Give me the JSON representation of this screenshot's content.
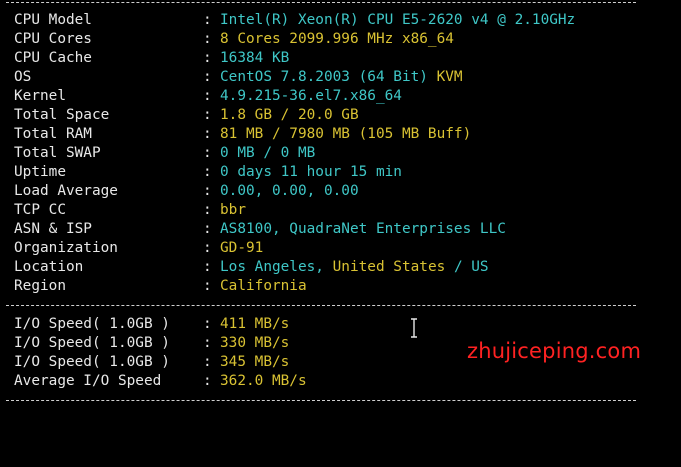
{
  "colors": {
    "background": "#000000",
    "label": "#e8e8e8",
    "separator": "#cfcfcf",
    "cyan": "#3fc7c7",
    "yellow": "#d9c233",
    "watermark": "#ff2222"
  },
  "system_info": [
    {
      "label": "CPU Model",
      "parts": [
        {
          "text": "Intel(R) Xeon(R) CPU E5-2620 v4 @ 2.10GHz",
          "color": "cyan"
        }
      ]
    },
    {
      "label": "CPU Cores",
      "parts": [
        {
          "text": "8 Cores 2099.996 MHz x86_64",
          "color": "yellow"
        }
      ]
    },
    {
      "label": "CPU Cache",
      "parts": [
        {
          "text": "16384 KB",
          "color": "cyan"
        }
      ]
    },
    {
      "label": "OS",
      "parts": [
        {
          "text": "CentOS 7.8.2003 (64 Bit) ",
          "color": "cyan"
        },
        {
          "text": "KVM",
          "color": "yellow"
        }
      ]
    },
    {
      "label": "Kernel",
      "parts": [
        {
          "text": "4.9.215-36.el7.x86_64",
          "color": "cyan"
        }
      ]
    },
    {
      "label": "Total Space",
      "parts": [
        {
          "text": "1.8 GB / 20.0 GB",
          "color": "yellow"
        }
      ]
    },
    {
      "label": "Total RAM",
      "parts": [
        {
          "text": "81 MB / 7980 MB (105 MB Buff)",
          "color": "yellow"
        }
      ]
    },
    {
      "label": "Total SWAP",
      "parts": [
        {
          "text": "0 MB / 0 MB",
          "color": "cyan"
        }
      ]
    },
    {
      "label": "Uptime",
      "parts": [
        {
          "text": "0 days 11 hour 15 min",
          "color": "cyan"
        }
      ]
    },
    {
      "label": "Load Average",
      "parts": [
        {
          "text": "0.00, 0.00, 0.00",
          "color": "cyan"
        }
      ]
    },
    {
      "label": "TCP CC",
      "parts": [
        {
          "text": "bbr",
          "color": "yellow"
        }
      ]
    },
    {
      "label": "ASN & ISP",
      "parts": [
        {
          "text": "AS8100, QuadraNet Enterprises LLC",
          "color": "cyan"
        }
      ]
    },
    {
      "label": "Organization",
      "parts": [
        {
          "text": "GD-91",
          "color": "yellow"
        }
      ]
    },
    {
      "label": "Location",
      "parts": [
        {
          "text": "Los Angeles, ",
          "color": "cyan"
        },
        {
          "text": "United States",
          "color": "yellow"
        },
        {
          "text": " / US",
          "color": "cyan"
        }
      ]
    },
    {
      "label": "Region",
      "parts": [
        {
          "text": "California",
          "color": "yellow"
        }
      ]
    }
  ],
  "io_speed": [
    {
      "label": "I/O Speed( 1.0GB )",
      "parts": [
        {
          "text": "411 MB/s",
          "color": "yellow"
        }
      ]
    },
    {
      "label": "I/O Speed( 1.0GB )",
      "parts": [
        {
          "text": "330 MB/s",
          "color": "yellow"
        }
      ]
    },
    {
      "label": "I/O Speed( 1.0GB )",
      "parts": [
        {
          "text": "345 MB/s",
          "color": "yellow"
        }
      ]
    },
    {
      "label": "Average I/O Speed",
      "parts": [
        {
          "text": "362.0 MB/s",
          "color": "yellow"
        }
      ]
    }
  ],
  "separator_char": ":",
  "watermark": "zhujiceping.com",
  "cursor_icon": "text-cursor-icon"
}
